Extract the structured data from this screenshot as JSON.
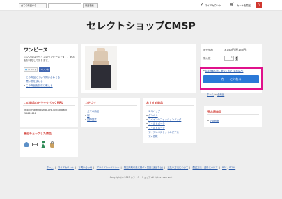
{
  "topbar": {
    "category_select": "全ての商品から",
    "search_placeholder": "",
    "search_button": "商品検索",
    "my_account": "マイアカウント",
    "cart_link": "カートを見る",
    "cart_count": "0"
  },
  "site": {
    "title": "セレクトショップCMSP"
  },
  "product": {
    "name": "ワンピース",
    "description": "シンプルなデザインのワンピースです。ご来店をお待ちしております。",
    "tweet": "ツイート",
    "like": "いいね!",
    "links": [
      "この商品について問い合わせる",
      "買い物を続ける",
      "この商品を友達に教える"
    ]
  },
  "trackback": {
    "title": "この商品のトラックバックURL",
    "url_line1": "http://hyarebtw.shop-pro.jp/trackback",
    "url_line2": "/59009018"
  },
  "recent": {
    "title": "最近チェックした商品"
  },
  "purchase": {
    "price_label": "販売価格",
    "price_value": "3,150円(税150円)",
    "qty_label": "購入数",
    "qty_value": "1",
    "legal_link": "特定商取引法に基づく表記 (返品など)",
    "cart_button": "カートに入れる"
  },
  "breadcrumb": {
    "home": "ホーム",
    "sep": ">",
    "current": "全商品"
  },
  "category": {
    "title": "カテゴリ",
    "items": [
      "全ての商品",
      "服",
      "国際雑貨"
    ]
  },
  "recommend": {
    "title": "おすすめ商品",
    "items": [
      "エコバッグ",
      "ダンベル",
      "スペインのファッションバッグ",
      "フェルトポーチ",
      "フェルトポーチ",
      "アイアンバスケットのピアス",
      "アメ色靴"
    ]
  },
  "bestsellers": {
    "title": "売れ筋商品",
    "items": [
      "アメ色靴"
    ]
  },
  "footer": {
    "links": [
      "ホーム",
      "マイアカウント",
      "お問い合わせ",
      "プライバシーポリシー",
      "特定商取引法に基づく表記 (返品など)",
      "支払い方法について",
      "配送方法・送料について",
      "RSS",
      "ATOM"
    ],
    "copyright": "Copyright(c) 2013 カラーミーショップ All rights reserved."
  },
  "colors": {
    "accent": "#d0372f",
    "button_blue": "#2b79d7",
    "highlight_pink": "#e0118b",
    "link": "#2a5aa8"
  }
}
